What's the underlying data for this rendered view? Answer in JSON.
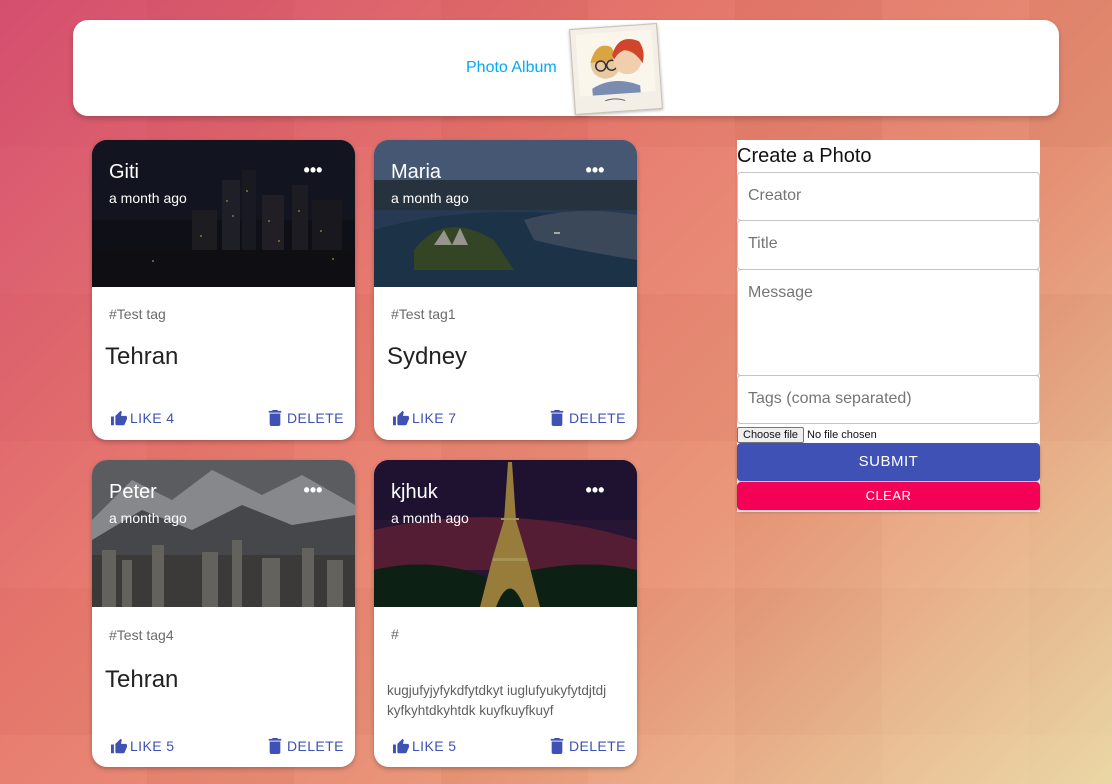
{
  "app": {
    "title": "Photo Album"
  },
  "posts": [
    {
      "creator": "Giti",
      "time": "a month ago",
      "tags": "#Test tag",
      "title": "Tehran",
      "message": "",
      "like_label": "LIKE 4",
      "delete_label": "DELETE"
    },
    {
      "creator": "Maria",
      "time": "a month ago",
      "tags": "#Test tag1",
      "title": "Sydney",
      "message": "",
      "like_label": "LIKE 7",
      "delete_label": "DELETE"
    },
    {
      "creator": "Peter",
      "time": "a month ago",
      "tags": "#Test tag4",
      "title": "Tehran",
      "message": "",
      "like_label": "LIKE 5",
      "delete_label": "DELETE"
    },
    {
      "creator": "kjhuk",
      "time": "a month ago",
      "tags": "#",
      "title": "",
      "message": "kugjufyjyfykdfytdkyt iuglufyukyfytdjtdj kyfkyhtdkyhtdk kuyfkuyfkuyf",
      "like_label": "LIKE 5",
      "delete_label": "DELETE"
    }
  ],
  "form": {
    "heading": "Create a Photo",
    "creator_placeholder": "Creator",
    "title_placeholder": "Title",
    "message_placeholder": "Message",
    "tags_placeholder": "Tags (coma separated)",
    "file_button": "Choose file",
    "file_status": "No file chosen",
    "submit_label": "SUBMIT",
    "clear_label": "CLEAR"
  },
  "colors": {
    "primary": "#3f51b5",
    "secondary": "#f50057",
    "title_link": "#03a9f4"
  }
}
